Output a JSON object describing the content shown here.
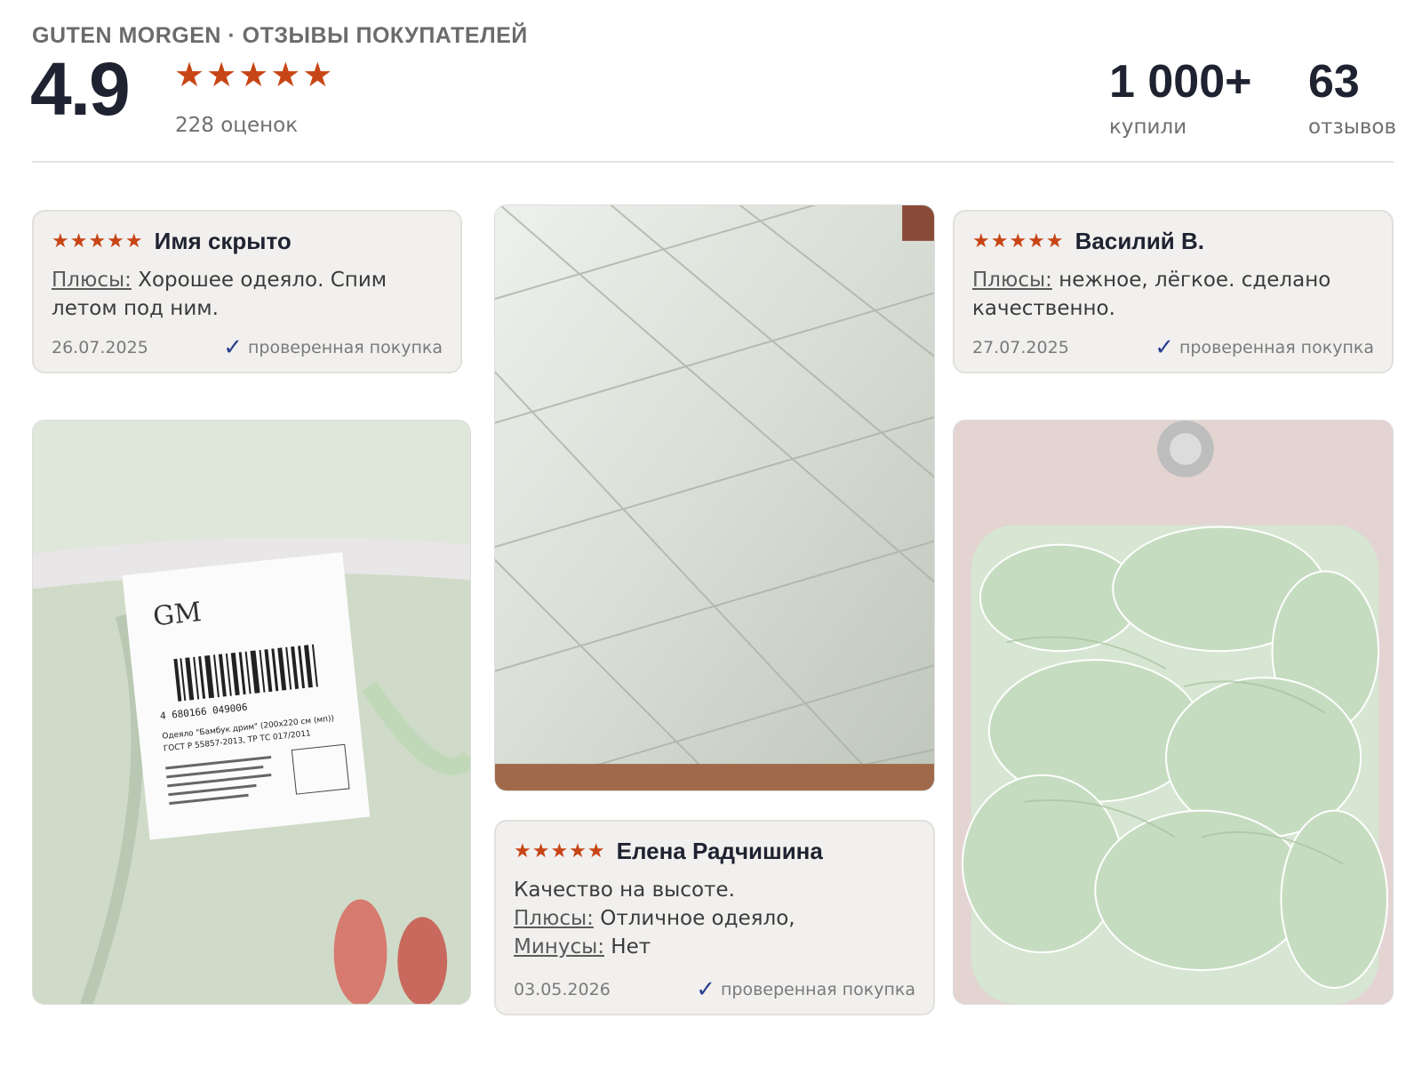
{
  "header": {
    "brand": "GUTEN MORGEN · ОТЗЫВЫ ПОКУПАТЕЛЕЙ",
    "rating": "4.9",
    "stars": "★★★★★",
    "ratings_count": "228 оценок",
    "bought_value": "1 000+",
    "bought_label": "купили",
    "reviews_value": "63",
    "reviews_label": "отзывов"
  },
  "reviews": [
    {
      "stars": "★★★★★",
      "author": "Имя скрыто",
      "pros_label": "Плюсы:",
      "pros_text": " Хорошее одеяло. Спим летом под ним.",
      "date": "26.07.2025",
      "verified": "проверенная покупка"
    },
    {
      "stars": "★★★★★",
      "author": "Василий В.",
      "pros_label": "Плюсы:",
      "pros_text": " нежное, лёгкое. сделано качественно.",
      "date": "27.07.2025",
      "verified": "проверенная покупка"
    },
    {
      "stars": "★★★★★",
      "author": "Елена Радчишина",
      "text": "Качество на высоте.",
      "pros_label": "Плюсы:",
      "pros_text": " Отличное одеяло,",
      "cons_label": "Минусы:",
      "cons_text": " Нет",
      "date": "03.05.2026",
      "verified": "проверенная покупка"
    }
  ],
  "photos": [
    {
      "label_text": "Одеяло \"Бамбук дрим\" (200x220 см (мп))",
      "barcode": "4 680166 049006",
      "standard": "ГОСТ Р 55857-2013, ТР ТС 017/2011"
    },
    {
      "subject": "quilted-blanket"
    },
    {
      "subject": "blanket-in-bathtub"
    }
  ],
  "colors": {
    "star": "#c84516",
    "verified_check": "#2a3f8f",
    "card_bg": "#f1f0ee"
  }
}
